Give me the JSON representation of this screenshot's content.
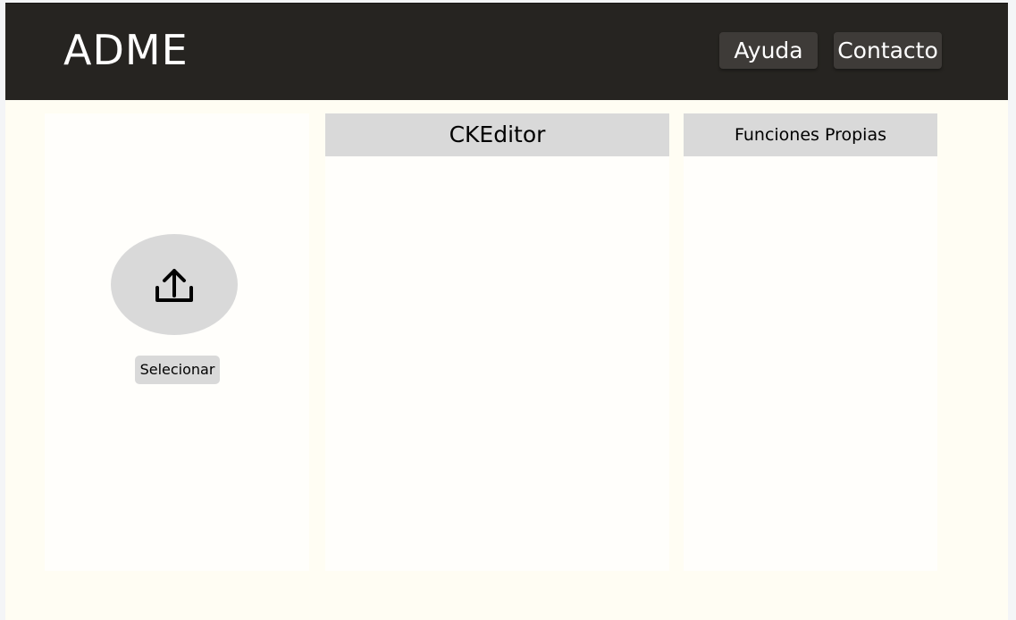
{
  "header": {
    "logo": "ADME",
    "nav": {
      "help_label": "Ayuda",
      "contact_label": "Contacto"
    }
  },
  "upload_panel": {
    "icon": "upload-icon",
    "select_label": "Selecionar"
  },
  "editor_panel": {
    "title": "CKEditor"
  },
  "functions_panel": {
    "title": "Funciones Propias"
  },
  "colors": {
    "header_bg": "#262421",
    "nav_button_bg": "#3e3b38",
    "page_bg": "#fffdf3",
    "panel_bg": "#fffefb",
    "panel_header_bg": "#d9d9d9"
  }
}
